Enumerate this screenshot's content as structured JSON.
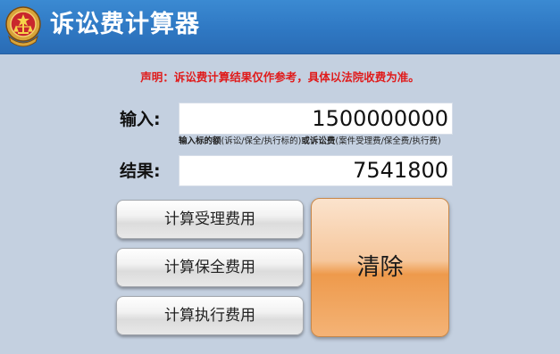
{
  "app": {
    "title": "诉讼费计算器"
  },
  "disclaimer": "声明：诉讼费计算结果仅作参考，具体以法院收费为准。",
  "input": {
    "label": "输入:",
    "value": "1500000000"
  },
  "hint": {
    "part1": "输入标的额",
    "part2": "(诉讼/保全/执行标的)",
    "part3": "或诉讼费",
    "part4": "(案件受理费/保全费/执行费)"
  },
  "result": {
    "label": "结果:",
    "value": "7541800"
  },
  "buttons": {
    "filing_fee": "计算受理费用",
    "preservation_fee": "计算保全费用",
    "execution_fee": "计算执行费用",
    "clear": "清除"
  },
  "colors": {
    "titlebar": "#2f78c3",
    "background": "#c4d0e0",
    "disclaimer": "#e01b1b",
    "clear_button": "#f6c79c"
  },
  "icons": {
    "emblem": "court-emblem-icon"
  }
}
